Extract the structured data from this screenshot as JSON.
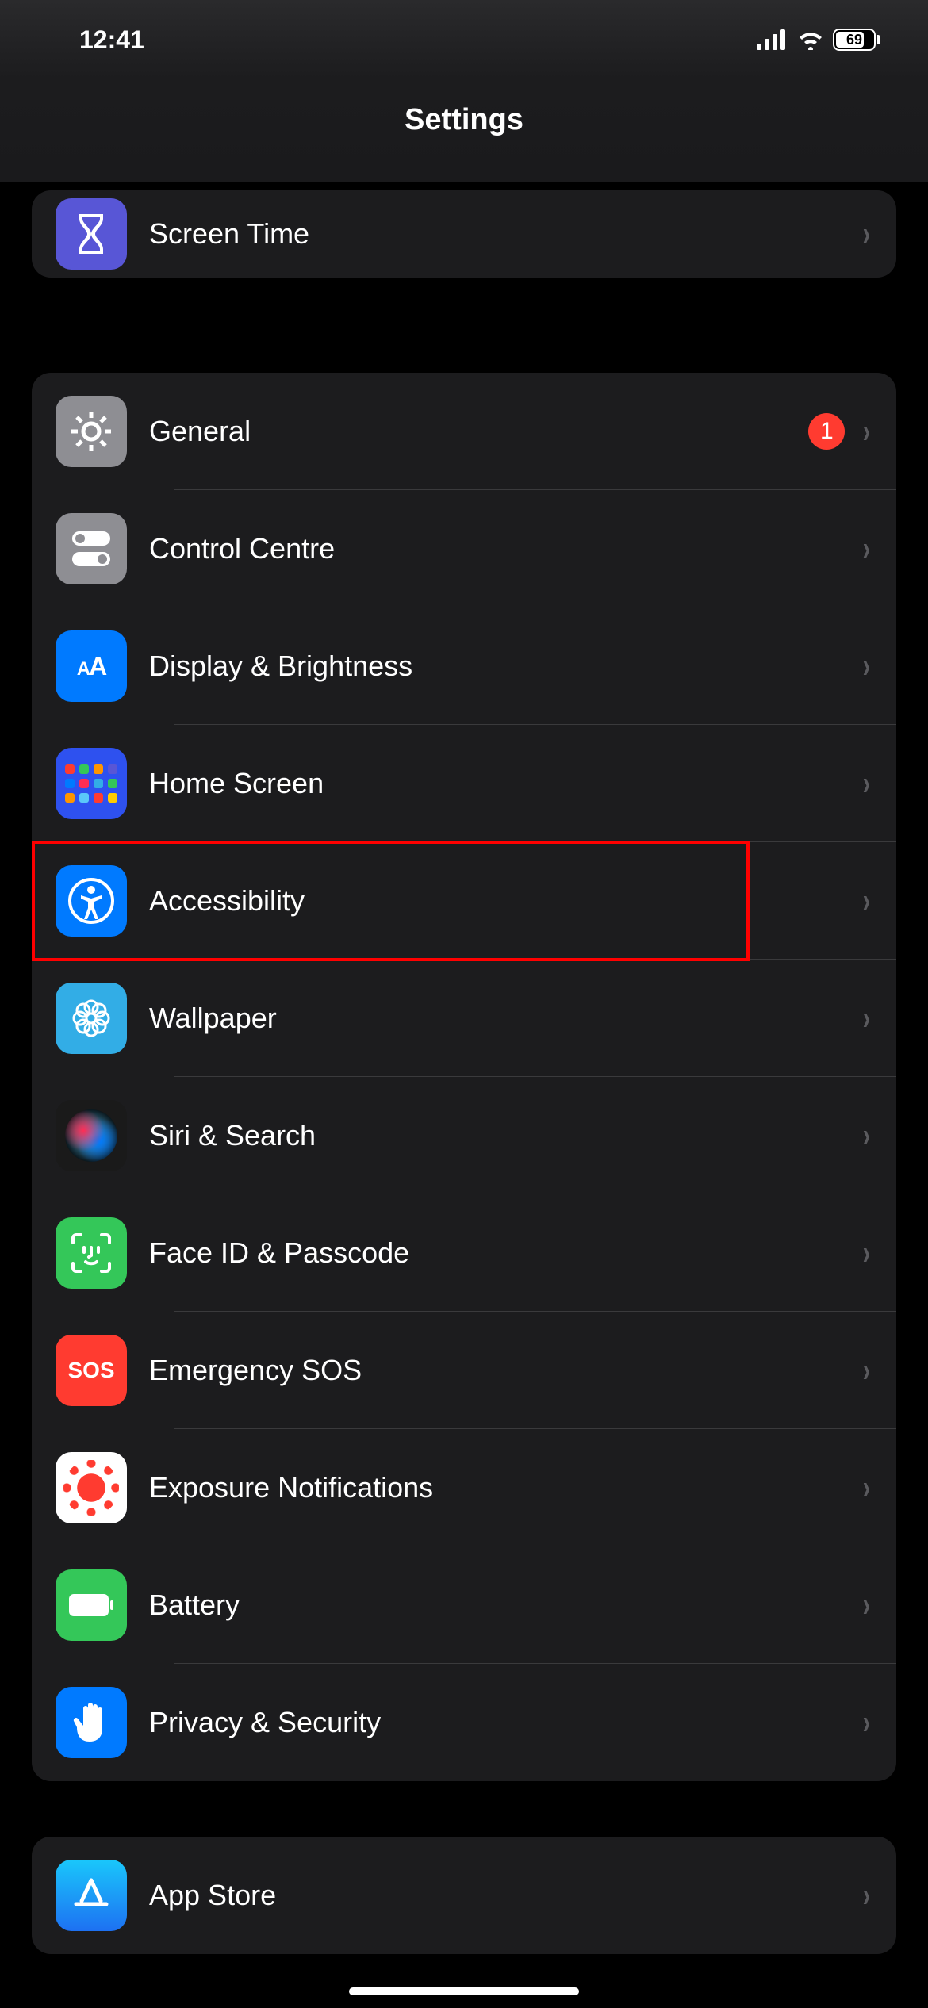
{
  "status": {
    "time": "12:41",
    "battery": "69"
  },
  "header": {
    "title": "Settings"
  },
  "groups": [
    {
      "rows": [
        {
          "icon": "hourglass-icon",
          "label": "Screen Time",
          "bg": "bg-purple"
        }
      ]
    },
    {
      "rows": [
        {
          "icon": "gear-icon",
          "label": "General",
          "bg": "bg-gray",
          "badge": "1"
        },
        {
          "icon": "switches-icon",
          "label": "Control Centre",
          "bg": "bg-gray"
        },
        {
          "icon": "text-size-icon",
          "label": "Display & Brightness",
          "bg": "bg-blue"
        },
        {
          "icon": "app-grid-icon",
          "label": "Home Screen",
          "bg": "bg-deep-blue"
        },
        {
          "icon": "accessibility-icon",
          "label": "Accessibility",
          "bg": "bg-blue",
          "highlight": true
        },
        {
          "icon": "flower-icon",
          "label": "Wallpaper",
          "bg": "bg-cyan"
        },
        {
          "icon": "siri-icon",
          "label": "Siri & Search",
          "bg": "bg-siri"
        },
        {
          "icon": "face-id-icon",
          "label": "Face ID & Passcode",
          "bg": "bg-green"
        },
        {
          "icon": "sos-icon",
          "label": "Emergency SOS",
          "bg": "bg-red"
        },
        {
          "icon": "exposure-icon",
          "label": "Exposure Notifications",
          "bg": "bg-white"
        },
        {
          "icon": "battery-icon",
          "label": "Battery",
          "bg": "bg-green"
        },
        {
          "icon": "hand-icon",
          "label": "Privacy & Security",
          "bg": "bg-blue"
        }
      ]
    },
    {
      "rows": [
        {
          "icon": "app-store-icon",
          "label": "App Store",
          "bg": "bg-blue"
        }
      ]
    }
  ]
}
